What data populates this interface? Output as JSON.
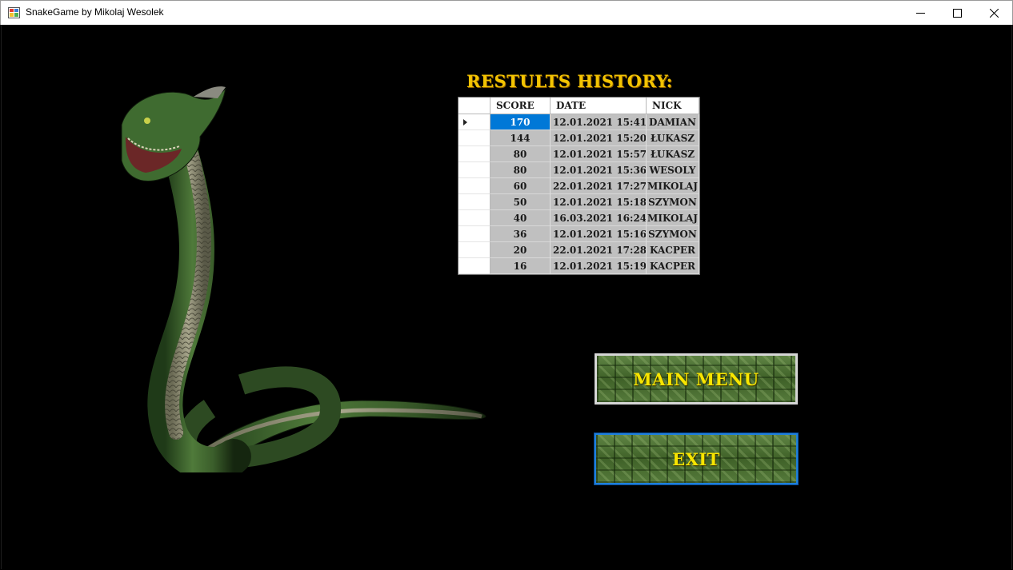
{
  "window": {
    "title": "SnakeGame by Mikolaj Wesolek",
    "icon": "winforms-app-icon",
    "controls": [
      "minimize-icon",
      "maximize-icon",
      "close-icon"
    ]
  },
  "history": {
    "title": "Restults History:",
    "columns": [
      "Score",
      "Date",
      "Nick"
    ],
    "selected_row": 0,
    "rows": [
      {
        "score": "170",
        "date": "12.01.2021 15:41",
        "nick": "DAMIAN"
      },
      {
        "score": "144",
        "date": "12.01.2021 15:20",
        "nick": "ŁUKASZ"
      },
      {
        "score": "80",
        "date": "12.01.2021 15:57",
        "nick": "ŁUKASZ"
      },
      {
        "score": "80",
        "date": "12.01.2021 15:36",
        "nick": "WESOLY"
      },
      {
        "score": "60",
        "date": "22.01.2021 17:27",
        "nick": "MIKOLAJ"
      },
      {
        "score": "50",
        "date": "12.01.2021 15:18",
        "nick": "SZYMON"
      },
      {
        "score": "40",
        "date": "16.03.2021 16:24",
        "nick": "MIKOLAJ"
      },
      {
        "score": "36",
        "date": "12.01.2021 15:16",
        "nick": "SZYMON"
      },
      {
        "score": "20",
        "date": "22.01.2021 17:28",
        "nick": "KACPER"
      },
      {
        "score": "16",
        "date": "12.01.2021 15:19",
        "nick": "KACPER"
      }
    ]
  },
  "buttons": {
    "main_menu": "Main Menu",
    "exit": "Exit"
  },
  "colors": {
    "title_text": "#f3c402",
    "button_text": "#f8e500",
    "selected_cell": "#0078d7",
    "grid_cell": "#c0c0c0"
  }
}
